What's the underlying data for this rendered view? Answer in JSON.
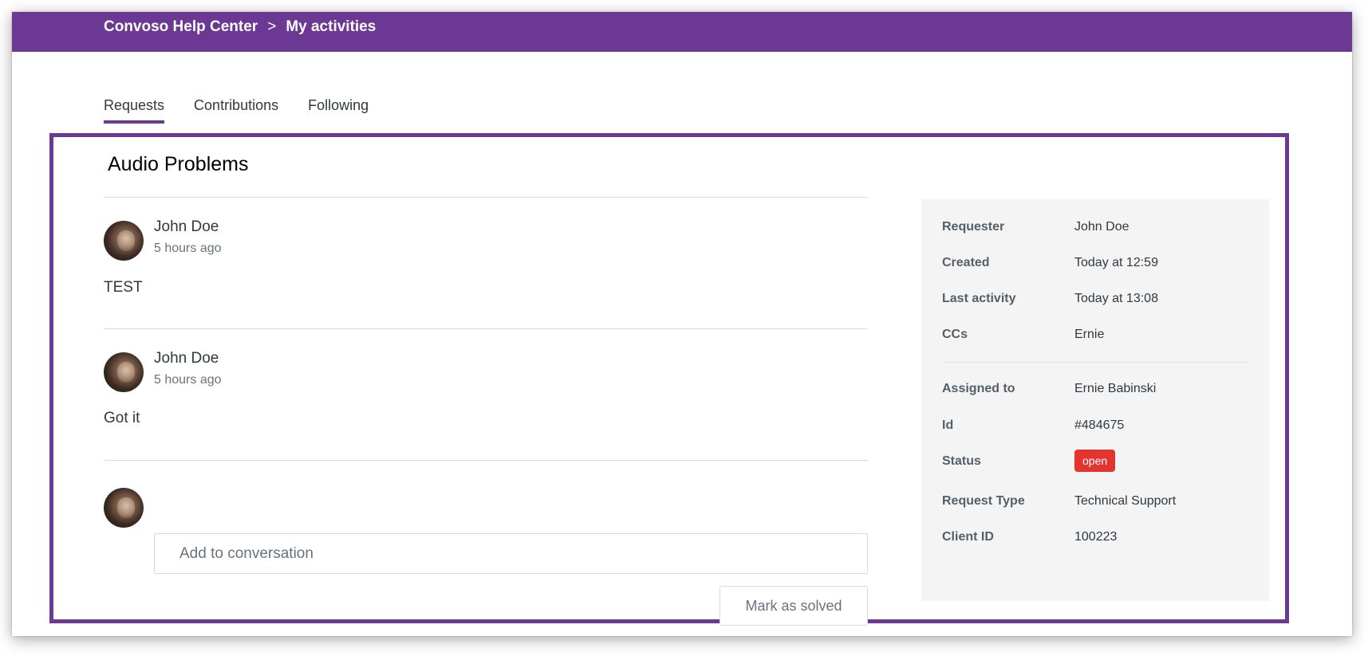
{
  "breadcrumb": {
    "home": "Convoso Help Center",
    "separator": ">",
    "current": "My activities"
  },
  "tabs": [
    {
      "label": "Requests",
      "active": true
    },
    {
      "label": "Contributions",
      "active": false
    },
    {
      "label": "Following",
      "active": false
    }
  ],
  "request": {
    "title": "Audio Problems"
  },
  "comments": [
    {
      "author": "John Doe",
      "time": "5 hours ago",
      "body": "TEST"
    },
    {
      "author": "John Doe",
      "time": "5 hours ago",
      "body": "Got it"
    }
  ],
  "composer": {
    "placeholder": "Add to conversation",
    "solve_label": "Mark as solved"
  },
  "details": {
    "requester": {
      "label": "Requester",
      "value": "John Doe"
    },
    "created": {
      "label": "Created",
      "value": "Today at 12:59"
    },
    "last_activity": {
      "label": "Last activity",
      "value": "Today at 13:08"
    },
    "ccs": {
      "label": "CCs",
      "value": "Ernie"
    },
    "assigned_to": {
      "label": "Assigned to",
      "value": "Ernie Babinski"
    },
    "id": {
      "label": "Id",
      "value": "#484675"
    },
    "status": {
      "label": "Status",
      "value": "open"
    },
    "request_type": {
      "label": "Request Type",
      "value": "Technical Support"
    },
    "client_id": {
      "label": "Client ID",
      "value": "100223"
    }
  },
  "colors": {
    "brand": "#6b3893",
    "status_open": "#e3342f",
    "sidebar_bg": "#f4f4f4"
  }
}
